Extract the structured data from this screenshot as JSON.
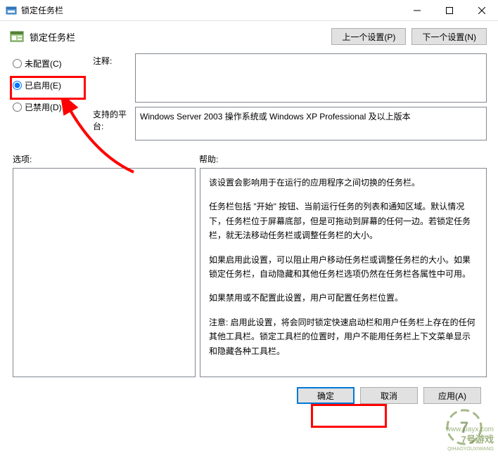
{
  "titlebar": {
    "title": "锁定任务栏"
  },
  "header": {
    "title": "锁定任务栏",
    "prev_btn": "上一个设置(P)",
    "next_btn": "下一个设置(N)"
  },
  "radios": {
    "not_configured": "未配置(C)",
    "enabled": "已启用(E)",
    "disabled": "已禁用(D)"
  },
  "fields": {
    "comment_label": "注释:",
    "comment_value": "",
    "platform_label": "支持的平台:",
    "platform_value": "Windows Server 2003 操作系统或 Windows XP Professional 及以上版本"
  },
  "sections": {
    "options": "选项:",
    "help": "帮助:"
  },
  "help": {
    "p1": "该设置会影响用于在运行的应用程序之间切换的任务栏。",
    "p2": "任务栏包括 \"开始\" 按钮、当前运行任务的列表和通知区域。默认情况下，任务栏位于屏幕底部，但是可拖动到屏幕的任何一边。若锁定任务栏，就无法移动任务栏或调整任务栏的大小。",
    "p3": "如果启用此设置，可以阻止用户移动任务栏或调整任务栏的大小。如果锁定任务栏，自动隐藏和其他任务栏选项仍然在任务栏各属性中可用。",
    "p4": "如果禁用或不配置此设置，用户可配置任务栏位置。",
    "p5": "注意: 启用此设置，将会同时锁定快速启动栏和用户任务栏上存在的任何其他工具栏。锁定工具栏的位置时，用户不能用任务栏上下文菜单显示和隐藏各种工具栏。"
  },
  "footer": {
    "ok": "确定",
    "cancel": "取消",
    "apply": "应用(A)"
  },
  "watermark": {
    "url": "www.xiayx.com",
    "brand": "7号游戏",
    "sub": "QIHAOYOUXIWANG"
  }
}
